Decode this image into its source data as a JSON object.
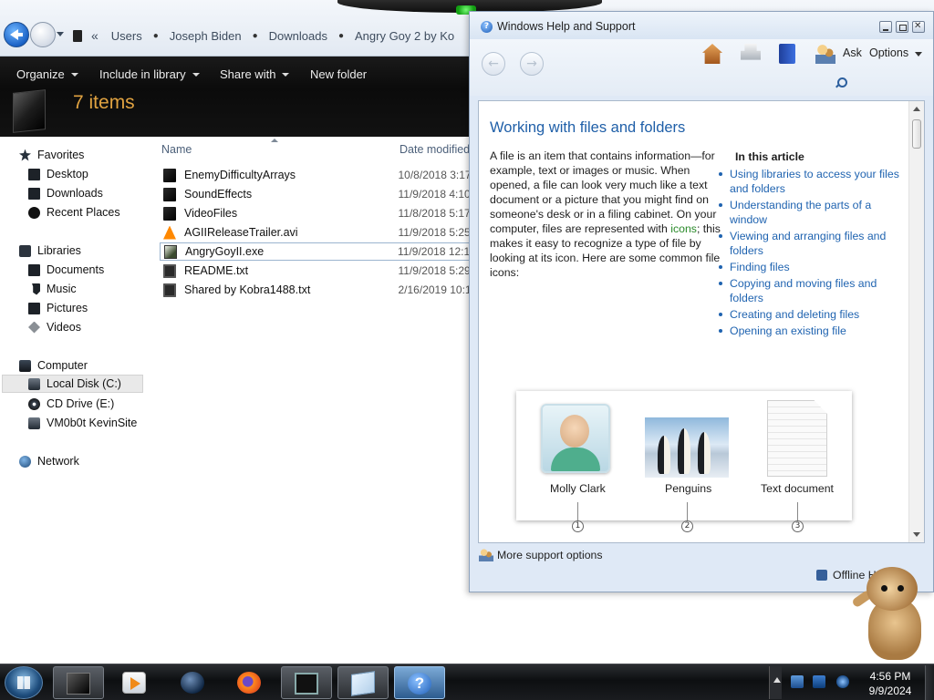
{
  "explorer": {
    "breadcrumb": [
      "Users",
      "Joseph Biden",
      "Downloads",
      "Angry Goy 2 by Ko"
    ],
    "overflow_chevron": "«",
    "toolbar": {
      "organize": "Organize",
      "include_in_library": "Include in library",
      "share_with": "Share with",
      "new_folder": "New folder"
    },
    "items_count": "7 items",
    "nav": {
      "favorites": "Favorites",
      "desktop": "Desktop",
      "downloads": "Downloads",
      "recent_places": "Recent Places",
      "libraries": "Libraries",
      "documents": "Documents",
      "music": "Music",
      "pictures": "Pictures",
      "videos": "Videos",
      "computer": "Computer",
      "local_disk": "Local Disk (C:)",
      "cd_drive": "CD Drive (E:)",
      "network_share": "VM0b0t KevinSite",
      "network": "Network"
    },
    "columns": {
      "name": "Name",
      "date_modified": "Date modified"
    },
    "files": [
      {
        "name": "EnemyDifficultyArrays",
        "date": "10/8/2018 3:17",
        "icon": "folder-icon"
      },
      {
        "name": "SoundEffects",
        "date": "11/9/2018 4:10",
        "icon": "folder-icon"
      },
      {
        "name": "VideoFiles",
        "date": "11/8/2018 5:17",
        "icon": "folder-icon"
      },
      {
        "name": "AGIIReleaseTrailer.avi",
        "date": "11/9/2018 5:25",
        "icon": "vlc-icon"
      },
      {
        "name": "AngryGoyII.exe",
        "date": "11/9/2018 12:1",
        "icon": "exe-icon"
      },
      {
        "name": "README.txt",
        "date": "11/9/2018 5:29",
        "icon": "text-file-icon"
      },
      {
        "name": "Shared by Kobra1488.txt",
        "date": "2/16/2019 10:1",
        "icon": "text-file-icon"
      }
    ]
  },
  "help": {
    "window_title": "Windows Help and Support",
    "toolbar": {
      "back": "←",
      "forward": "→",
      "ask": "Ask",
      "options": "Options"
    },
    "article_title": "Working with files and folders",
    "body_before_link": "A file is an item that contains information—for example, text or images or music. When opened, a file can look very much like a text document or a picture that you might find on someone's desk or in a filing cabinet. On your computer, files are represented with ",
    "body_link": "icons",
    "body_after_link": "; this makes it easy to recognize a type of file by looking at its icon. Here are some common file icons:",
    "in_this_article": "In this article",
    "toc": [
      "Using libraries to access your files and folders",
      "Understanding the parts of a window",
      "Viewing and arranging files and folders",
      "Finding files",
      "Copying and moving files and folders",
      "Creating and deleting files",
      "Opening an existing file"
    ],
    "icon_examples": [
      {
        "label": "Molly Clark",
        "number": "1"
      },
      {
        "label": "Penguins",
        "number": "2"
      },
      {
        "label": "Text document",
        "number": "3"
      }
    ],
    "more_support": "More support options",
    "offline_help": "Offline Help"
  },
  "taskbar": {
    "time": "4:56 PM",
    "date": "9/9/2024",
    "help_glyph": "?"
  },
  "colors": {
    "accent_link": "#1f63b0",
    "items_count": "#e1a341",
    "toolbar_bg": "#0b0b0b"
  }
}
